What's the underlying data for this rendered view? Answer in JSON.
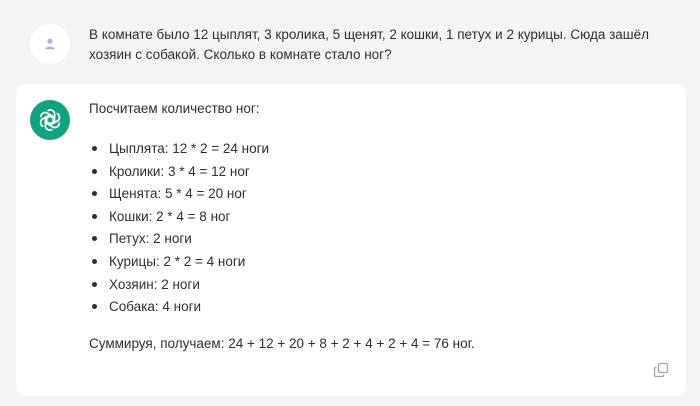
{
  "user_message": {
    "text": "В комнате было 12 цыплят, 3 кролика, 5 щенят, 2 кошки, 1 петух и 2 курицы. Сюда зашёл хозяин с собакой. Сколько в комнате стало ног?",
    "avatar_icon": "user-icon",
    "avatar_color": "#b9a7f2"
  },
  "assistant_message": {
    "intro": "Посчитаем количество ног:",
    "items": [
      "Цыплята: 12 * 2 = 24 ноги",
      "Кролики: 3 * 4 = 12 ног",
      "Щенята: 5 * 4 = 20 ног",
      "Кошки: 2 * 4 = 8 ног",
      "Петух: 2 ноги",
      "Курицы: 2 * 2 = 4 ноги",
      "Хозяин: 2 ноги",
      "Собака: 4 ноги"
    ],
    "summary": "Суммируя, получаем: 24 + 12 + 20 + 8 + 2 + 4 + 2 + 4 = 76 ног.",
    "avatar_icon": "openai-logo-icon",
    "avatar_color": "#10a37f",
    "copy_icon": "copy-icon"
  }
}
